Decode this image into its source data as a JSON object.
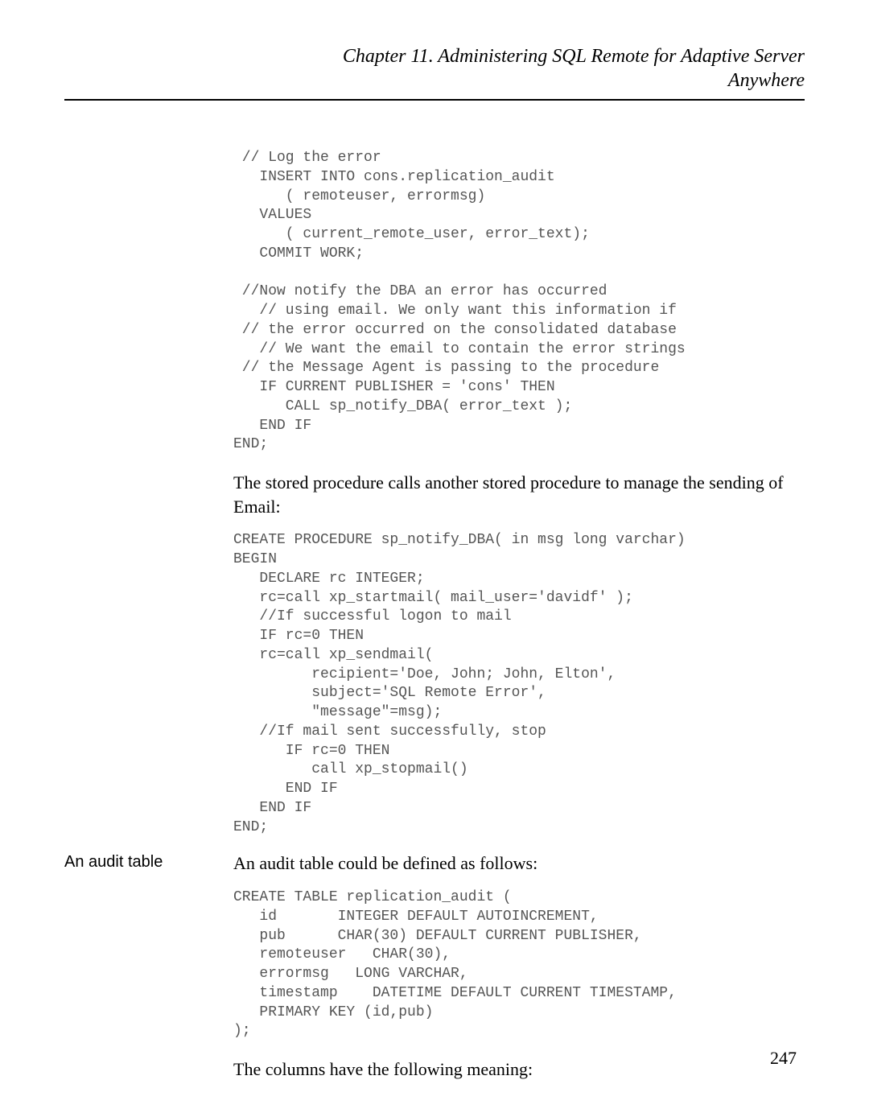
{
  "header": {
    "line1": "Chapter 11.  Administering SQL Remote for Adaptive Server",
    "line2": "Anywhere"
  },
  "code1": " // Log the error\n   INSERT INTO cons.replication_audit\n      ( remoteuser, errormsg)\n   VALUES\n      ( current_remote_user, error_text);\n   COMMIT WORK;\n\n //Now notify the DBA an error has occurred\n   // using email. We only want this information if\n // the error occurred on the consolidated database\n   // We want the email to contain the error strings\n // the Message Agent is passing to the procedure\n   IF CURRENT PUBLISHER = 'cons' THEN\n      CALL sp_notify_DBA( error_text );\n   END IF\nEND;",
  "para1": "The stored procedure calls another stored procedure to manage the sending of Email:",
  "code2": "CREATE PROCEDURE sp_notify_DBA( in msg long varchar)\nBEGIN\n   DECLARE rc INTEGER;\n   rc=call xp_startmail( mail_user='davidf' );\n   //If successful logon to mail\n   IF rc=0 THEN\n   rc=call xp_sendmail(\n         recipient='Doe, John; John, Elton',\n         subject='SQL Remote Error',\n         \"message\"=msg);\n   //If mail sent successfully, stop\n      IF rc=0 THEN\n         call xp_stopmail()\n      END IF\n   END IF\nEND;",
  "sidebar": {
    "audit_label": "An audit table"
  },
  "para2": "An audit table could be defined as follows:",
  "code3": "CREATE TABLE replication_audit (\n   id       INTEGER DEFAULT AUTOINCREMENT,\n   pub      CHAR(30) DEFAULT CURRENT PUBLISHER,\n   remoteuser   CHAR(30),\n   errormsg   LONG VARCHAR,\n   timestamp    DATETIME DEFAULT CURRENT TIMESTAMP,\n   PRIMARY KEY (id,pub)\n);",
  "para3": "The columns have the following meaning:",
  "page_number": "247"
}
